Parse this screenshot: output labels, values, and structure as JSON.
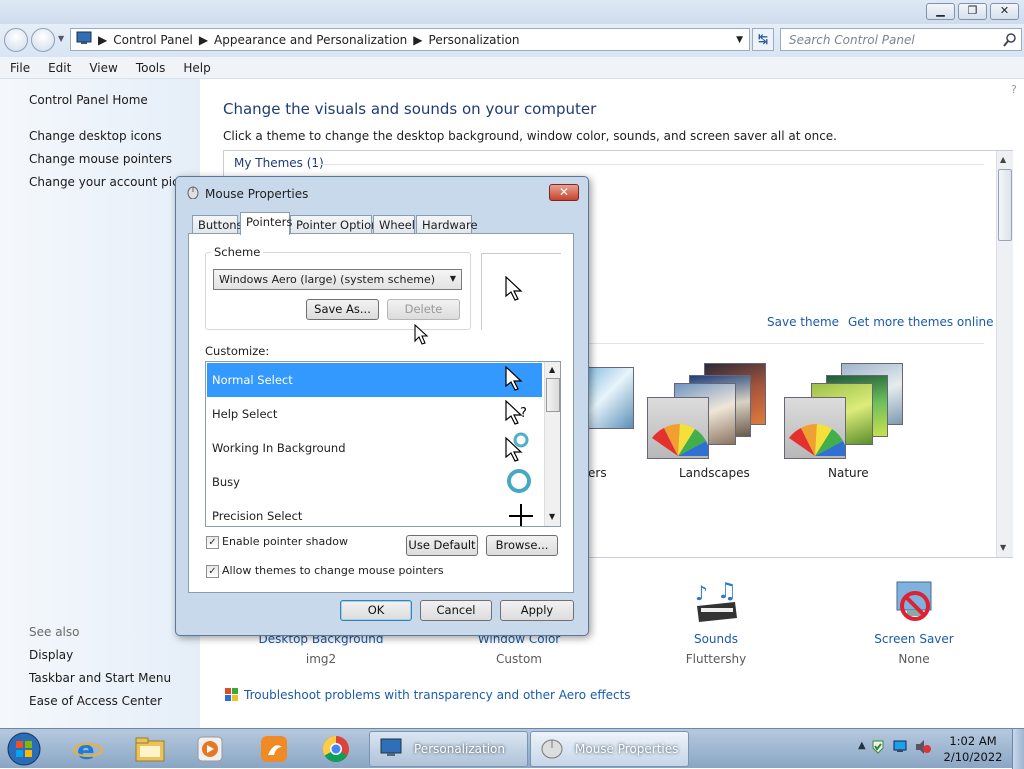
{
  "window": {
    "minimize": "▁",
    "maximize": "❐",
    "close": "✕"
  },
  "breadcrumb": [
    "Control Panel",
    "Appearance and Personalization",
    "Personalization"
  ],
  "search": {
    "placeholder": "Search Control Panel"
  },
  "menu": [
    "File",
    "Edit",
    "View",
    "Tools",
    "Help"
  ],
  "sidebar": {
    "home": "Control Panel Home",
    "links": [
      "Change desktop icons",
      "Change mouse pointers",
      "Change your account pictu"
    ],
    "see_also_label": "See also",
    "see_also": [
      "Display",
      "Taskbar and Start Menu",
      "Ease of Access Center"
    ]
  },
  "main": {
    "title": "Change the visuals and sounds on your computer",
    "subtitle": "Click a theme to change the desktop background, window color, sounds, and screen saver all at once.",
    "my_themes": "My Themes (1)",
    "save_theme": "Save theme",
    "get_more": "Get more themes online",
    "themes": [
      "ers",
      "Landscapes",
      "Nature"
    ],
    "bottom": [
      {
        "label": "Desktop Background",
        "value": "img2"
      },
      {
        "label": "Window Color",
        "value": "Custom"
      },
      {
        "label": "Sounds",
        "value": "Fluttershy"
      },
      {
        "label": "Screen Saver",
        "value": "None"
      }
    ],
    "troubleshoot": "Troubleshoot problems with transparency and other Aero effects"
  },
  "dialog": {
    "title": "Mouse Properties",
    "tabs": [
      "Buttons",
      "Pointers",
      "Pointer Options",
      "Wheel",
      "Hardware"
    ],
    "scheme_label": "Scheme",
    "scheme_value": "Windows Aero (large) (system scheme)",
    "save_as": "Save As...",
    "delete": "Delete",
    "customize_label": "Customize:",
    "pointers": [
      "Normal Select",
      "Help Select",
      "Working In Background",
      "Busy",
      "Precision Select"
    ],
    "enable_shadow": "Enable pointer shadow",
    "allow_themes": "Allow themes to change mouse pointers",
    "use_default": "Use Default",
    "browse": "Browse...",
    "ok": "OK",
    "cancel": "Cancel",
    "apply": "Apply"
  },
  "taskbar": {
    "windows": [
      "Personalization",
      "Mouse Properties"
    ],
    "time": "1:02 AM",
    "date": "2/10/2022"
  }
}
